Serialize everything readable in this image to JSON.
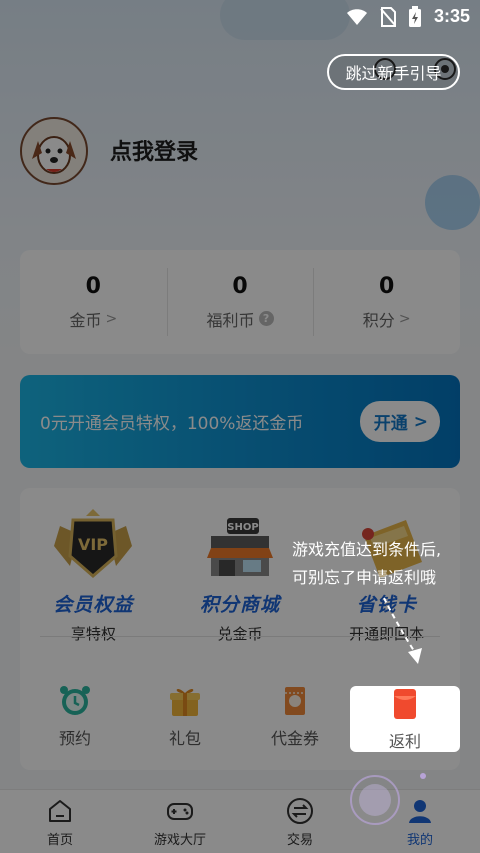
{
  "status_bar": {
    "time": "3:35"
  },
  "profile": {
    "login_text": "点我登录"
  },
  "stats": [
    {
      "value": "0",
      "label": "金币",
      "suffix": "chevron"
    },
    {
      "value": "0",
      "label": "福利币",
      "suffix": "question"
    },
    {
      "value": "0",
      "label": "积分",
      "suffix": "chevron"
    }
  ],
  "vip_banner": {
    "text": "0元开通会员特权，100%返还金币",
    "button": "开通"
  },
  "features": [
    {
      "title": "会员权益",
      "subtitle": "享特权",
      "icon": "vip-badge-icon"
    },
    {
      "title": "积分商城",
      "subtitle": "兑金币",
      "icon": "shop-icon"
    },
    {
      "title": "省钱卡",
      "subtitle": "开通即回本",
      "icon": "card-icon"
    }
  ],
  "quick_actions": [
    {
      "label": "预约",
      "icon": "alarm-clock-icon"
    },
    {
      "label": "礼包",
      "icon": "gift-icon"
    },
    {
      "label": "代金券",
      "icon": "voucher-icon"
    },
    {
      "label": "返利",
      "icon": "red-envelope-icon"
    }
  ],
  "bottom_nav": [
    {
      "label": "首页",
      "icon": "home-icon",
      "active": false
    },
    {
      "label": "游戏大厅",
      "icon": "gamepad-icon",
      "active": false
    },
    {
      "label": "交易",
      "icon": "exchange-icon",
      "active": false
    },
    {
      "label": "我的",
      "icon": "user-icon",
      "active": true
    }
  ],
  "guide": {
    "skip": "跳过新手引导",
    "tip_line1": "游戏充值达到条件后,",
    "tip_line2": "可别忘了申请返利哦"
  },
  "colors": {
    "accent": "#1f64d6",
    "banner": "#0e8fd0",
    "rebate": "#f04a2e",
    "overlay": "rgba(0,0,0,0.46)"
  }
}
